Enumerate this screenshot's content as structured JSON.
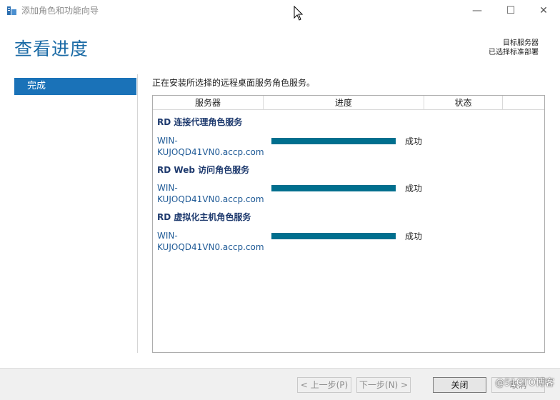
{
  "window": {
    "title": "添加角色和功能向导",
    "minimize_glyph": "—",
    "maximize_glyph": "☐",
    "close_glyph": "✕"
  },
  "header": {
    "title": "查看进度",
    "destination_line1": "目标服务器",
    "destination_line2": "已选择标准部署"
  },
  "nav": {
    "items": [
      {
        "label": "完成",
        "selected": true
      }
    ]
  },
  "content": {
    "description": "正在安装所选择的远程桌面服务角色服务。",
    "columns": [
      "服务器",
      "进度",
      "状态",
      ""
    ],
    "groups": [
      {
        "title": "RD 连接代理角色服务",
        "server_line1": "WIN-",
        "server_line2": "KUJOQD41VN0.accp.com",
        "progress": 1.0,
        "status": "成功"
      },
      {
        "title": "RD Web 访问角色服务",
        "server_line1": "WIN-",
        "server_line2": "KUJOQD41VN0.accp.com",
        "progress": 1.0,
        "status": "成功"
      },
      {
        "title": "RD 虚拟化主机角色服务",
        "server_line1": "WIN-",
        "server_line2": "KUJOQD41VN0.accp.com",
        "progress": 1.0,
        "status": "成功"
      }
    ]
  },
  "footer": {
    "prev_label": "< 上一步(P)",
    "next_label": "下一步(N) >",
    "close_label": "关闭",
    "cancel_label": "取消"
  },
  "watermark": "@51CTO博客",
  "colors": {
    "accent": "#1a72b8",
    "title_blue": "#1a6aa5",
    "progress": "#006f8e"
  }
}
